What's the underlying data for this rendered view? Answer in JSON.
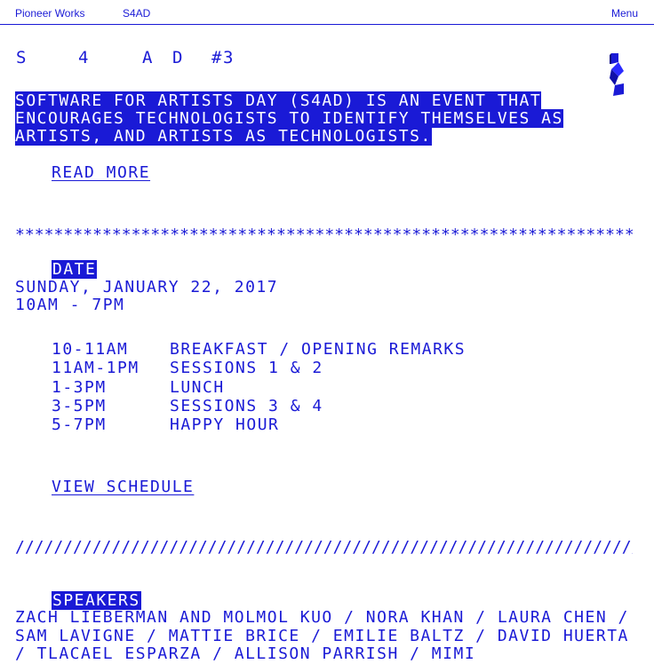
{
  "nav": {
    "brand": "Pioneer Works",
    "section": "S4AD",
    "menu": "Menu"
  },
  "title": {
    "chars": [
      "S",
      "4",
      "A",
      "D",
      "#3"
    ]
  },
  "intro": {
    "line1": "SOFTWARE FOR ARTISTS DAY (S4AD) IS AN EVENT THAT",
    "line2": "ENCOURAGES TECHNOLOGISTS TO IDENTIFY THEMSELVES AS",
    "line3": "ARTISTS, AND ARTISTS AS TECHNOLOGISTS.",
    "read_more": "READ MORE"
  },
  "dividers": {
    "stars": "*************************************************************************",
    "slashes": "//////////////////////////////////////////////////////////////////////////"
  },
  "date": {
    "label": "DATE",
    "day": "SUNDAY, JANUARY 22, 2017",
    "hours": "10AM - 7PM"
  },
  "schedule": [
    {
      "time": "10-11AM",
      "event": "BREAKFAST / OPENING REMARKS"
    },
    {
      "time": "11AM-1PM",
      "event": "SESSIONS 1 & 2"
    },
    {
      "time": "1-3PM",
      "event": "LUNCH"
    },
    {
      "time": "3-5PM",
      "event": "SESSIONS 3 & 4"
    },
    {
      "time": "5-7PM",
      "event": "HAPPY HOUR"
    }
  ],
  "view_schedule": "VIEW SCHEDULE",
  "speakers": {
    "label": "SPEAKERS",
    "list": "ZACH LIEBERMAN AND MOLMOL KUO / NORA KHAN / LAURA CHEN / SAM LAVIGNE / MATTIE BRICE / EMILIE BALTZ / DAVID HUERTA / TLACAEL ESPARZA / ALLISON PARRISH / MIMI"
  },
  "colors": {
    "accent": "#1a1ad6",
    "background": "#ffffff"
  },
  "icons": {
    "logo": "s-ribbon-logo-icon"
  }
}
